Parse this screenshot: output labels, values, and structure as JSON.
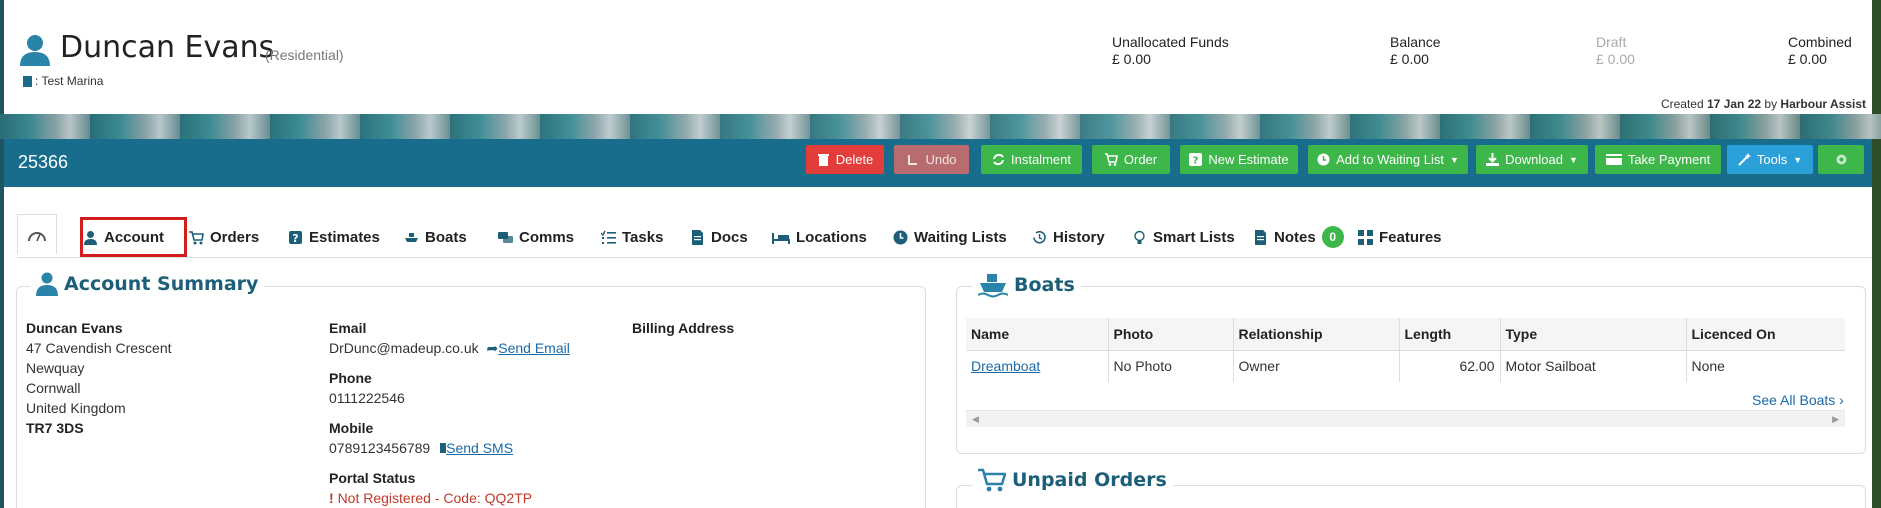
{
  "header": {
    "name": "Duncan Evans",
    "type": "(Residential)",
    "marina": ": Test Marina",
    "finance": [
      {
        "label": "Unallocated Funds",
        "value": "£ 0.00"
      },
      {
        "label": "Balance",
        "value": "£ 0.00"
      },
      {
        "label": "Draft",
        "value": "£ 0.00"
      },
      {
        "label": "Combined",
        "value": "£ 0.00"
      }
    ],
    "created_prefix": "Created",
    "created_date": "17 Jan 22",
    "created_by_prefix": "by",
    "created_by": "Harbour Assist"
  },
  "toolbar": {
    "account_id": "25366",
    "buttons": {
      "delete": "Delete",
      "undo": "Undo",
      "instalment": "Instalment",
      "order": "Order",
      "new_estimate": "New Estimate",
      "waiting_list": "Add to Waiting List",
      "download": "Download",
      "take_payment": "Take Payment",
      "tools": "Tools"
    }
  },
  "tabs": {
    "account": "Account",
    "orders": "Orders",
    "estimates": "Estimates",
    "boats": "Boats",
    "comms": "Comms",
    "tasks": "Tasks",
    "docs": "Docs",
    "locations": "Locations",
    "waiting_lists": "Waiting Lists",
    "history": "History",
    "smart_lists": "Smart Lists",
    "notes": "Notes",
    "notes_count": "0",
    "features": "Features"
  },
  "account_summary": {
    "title": "Account Summary",
    "address": {
      "name": "Duncan Evans",
      "line1": "47 Cavendish Crescent",
      "line2": "Newquay",
      "line3": "Cornwall",
      "line4": "United Kingdom",
      "postcode": "TR7 3DS"
    },
    "email_label": "Email",
    "email": "DrDunc@madeup.co.uk",
    "send_email": "Send Email",
    "phone_label": "Phone",
    "phone": "0111222546",
    "mobile_label": "Mobile",
    "mobile": "0789123456789",
    "send_sms": "Send SMS",
    "portal_label": "Portal Status",
    "portal_status": "Not Registered - Code: QQ2TP",
    "billing_label": "Billing Address"
  },
  "boats": {
    "title": "Boats",
    "columns": [
      "Name",
      "Photo",
      "Relationship",
      "Length",
      "Type",
      "Licenced On"
    ],
    "rows": [
      {
        "name": "Dreamboat",
        "photo": "No Photo",
        "relationship": "Owner",
        "length": "62.00",
        "type": "Motor Sailboat",
        "licenced_on": "None"
      }
    ],
    "see_all": "See All Boats"
  },
  "unpaid_orders": {
    "title": "Unpaid Orders"
  },
  "colors": {
    "toolbar": "#186d8d",
    "green": "#3db64a",
    "red": "#e23d3a",
    "blue": "#2a9fd8",
    "heading": "#1d5e78",
    "active_tab_border": "#d31c1c"
  }
}
